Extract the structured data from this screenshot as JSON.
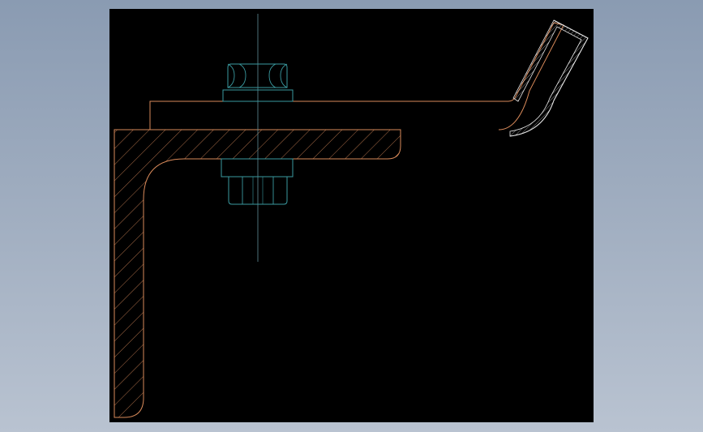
{
  "drawing": {
    "background_color": "#8a9bb2",
    "viewport_color": "#000000",
    "colors": {
      "angle_bracket": "#d98a5a",
      "fastener": "#3a9aa0",
      "centerline": "#5f8e98",
      "clip_section": "#e8e8e8"
    },
    "parts": [
      "angle-bracket-section",
      "flat-bar",
      "bolt-centerline",
      "hex-nut-top",
      "washer-top",
      "washer-bottom",
      "hex-nut-bottom",
      "bent-clip-section"
    ]
  }
}
